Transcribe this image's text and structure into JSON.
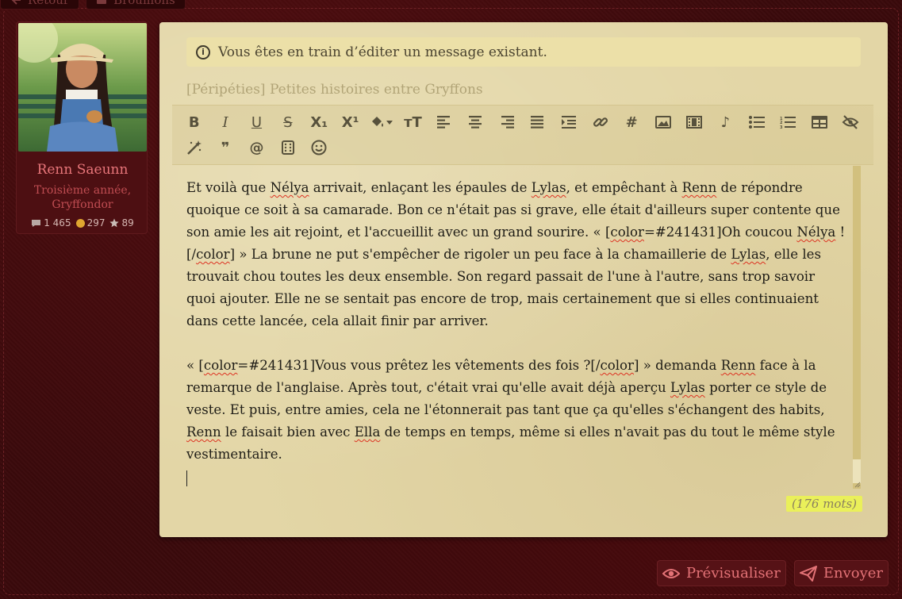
{
  "top_tabs": [
    {
      "label": "Retour",
      "icon": "arrow-left-icon"
    },
    {
      "label": "Brouillons",
      "icon": "drafts-icon"
    }
  ],
  "profile": {
    "name": "Renn Saeunn",
    "rank": "Troisième année, Gryffondor",
    "stats": {
      "messages": "1 465",
      "coins": "297",
      "stars": "89"
    }
  },
  "editor": {
    "notice": "Vous êtes en train d’éditer un message existant.",
    "subject": "[Péripéties] Petites histoires entre Gryffons",
    "toolbar": [
      {
        "icon": "bold-icon",
        "label": "B"
      },
      {
        "icon": "italic-icon",
        "label": "I"
      },
      {
        "icon": "underline-icon",
        "label": "U"
      },
      {
        "icon": "strikethrough-icon",
        "label": "S"
      },
      {
        "icon": "subscript-icon",
        "label": "X₁"
      },
      {
        "icon": "superscript-icon",
        "label": "X¹"
      },
      {
        "icon": "fill-color-icon",
        "label": ""
      },
      {
        "icon": "font-size-icon",
        "label": "ᴛT"
      },
      {
        "icon": "align-left-icon",
        "label": ""
      },
      {
        "icon": "align-center-icon",
        "label": ""
      },
      {
        "icon": "align-right-icon",
        "label": ""
      },
      {
        "icon": "align-justify-icon",
        "label": ""
      },
      {
        "icon": "indent-icon",
        "label": ""
      },
      {
        "icon": "link-icon",
        "label": ""
      },
      {
        "icon": "hashtag-icon",
        "label": "#"
      },
      {
        "icon": "image-icon",
        "label": ""
      },
      {
        "icon": "video-icon",
        "label": ""
      },
      {
        "icon": "music-icon",
        "label": "♪"
      },
      {
        "icon": "bullet-list-icon",
        "label": ""
      },
      {
        "icon": "numbered-list-icon",
        "label": ""
      },
      {
        "icon": "table-icon",
        "label": ""
      },
      {
        "icon": "hide-icon",
        "label": ""
      },
      {
        "icon": "magic-wand-icon",
        "label": ""
      },
      {
        "icon": "quote-icon",
        "label": "❞"
      },
      {
        "icon": "mention-icon",
        "label": "@"
      },
      {
        "icon": "dice-icon",
        "label": ""
      },
      {
        "icon": "smiley-icon",
        "label": "☺"
      }
    ],
    "body": {
      "p1": [
        {
          "t": "Et voilà que "
        },
        {
          "t": "Nélya",
          "sp": true
        },
        {
          "t": " arrivait, enlaçant les épaules de "
        },
        {
          "t": "Lylas",
          "sp": true
        },
        {
          "t": ", et empêchant à "
        },
        {
          "t": "Renn",
          "sp": true
        },
        {
          "t": " de répondre quoique ce soit à sa camarade. Bon ce n'était pas si grave, elle était d'ailleurs super contente que son amie les ait rejoint, et l'accueillit avec un grand sourire. « ["
        },
        {
          "t": "color",
          "sp": true
        },
        {
          "t": "=#241431]Oh coucou "
        },
        {
          "t": "Nélya",
          "sp": true
        },
        {
          "t": " ![/"
        },
        {
          "t": "color",
          "sp": true
        },
        {
          "t": "] » La brune ne put s'empêcher de rigoler un peu face à la chamaillerie de "
        },
        {
          "t": "Lylas",
          "sp": true
        },
        {
          "t": ", elle les trouvait chou toutes les deux ensemble. Son regard passait de l'une à l'autre, sans trop savoir quoi ajouter. Elle ne se sentait pas encore de trop, mais certainement que si elles continuaient dans cette lancée, cela allait finir par arriver."
        }
      ],
      "p2": [
        {
          "t": "« ["
        },
        {
          "t": "color",
          "sp": true
        },
        {
          "t": "=#241431]Vous vous prêtez les vêtements des fois ?[/"
        },
        {
          "t": "color",
          "sp": true
        },
        {
          "t": "] » demanda "
        },
        {
          "t": "Renn",
          "sp": true
        },
        {
          "t": " face à la remarque de l'anglaise. Après tout, c'était vrai qu'elle avait déjà aperçu "
        },
        {
          "t": "Lylas",
          "sp": true
        },
        {
          "t": " porter ce style de veste. Et puis, entre amies, cela ne l'étonnerait pas tant que ça qu'elles s'échangent des habits, "
        },
        {
          "t": "Renn",
          "sp": true
        },
        {
          "t": " le faisait bien avec "
        },
        {
          "t": "Ella",
          "sp": true
        },
        {
          "t": " de temps en temps, même si elles n'avait pas du tout le même style vestimentaire."
        }
      ]
    },
    "word_count": "(176 mots)"
  },
  "actions": {
    "preview_label": "Prévisualiser",
    "send_label": "Envoyer"
  },
  "colors": {
    "background": "#3b0a0c",
    "panel": "#e3d6a6",
    "accent": "#e47377",
    "notice_bg": "#ece0a8",
    "word_count_highlight": "#eaf05a"
  }
}
